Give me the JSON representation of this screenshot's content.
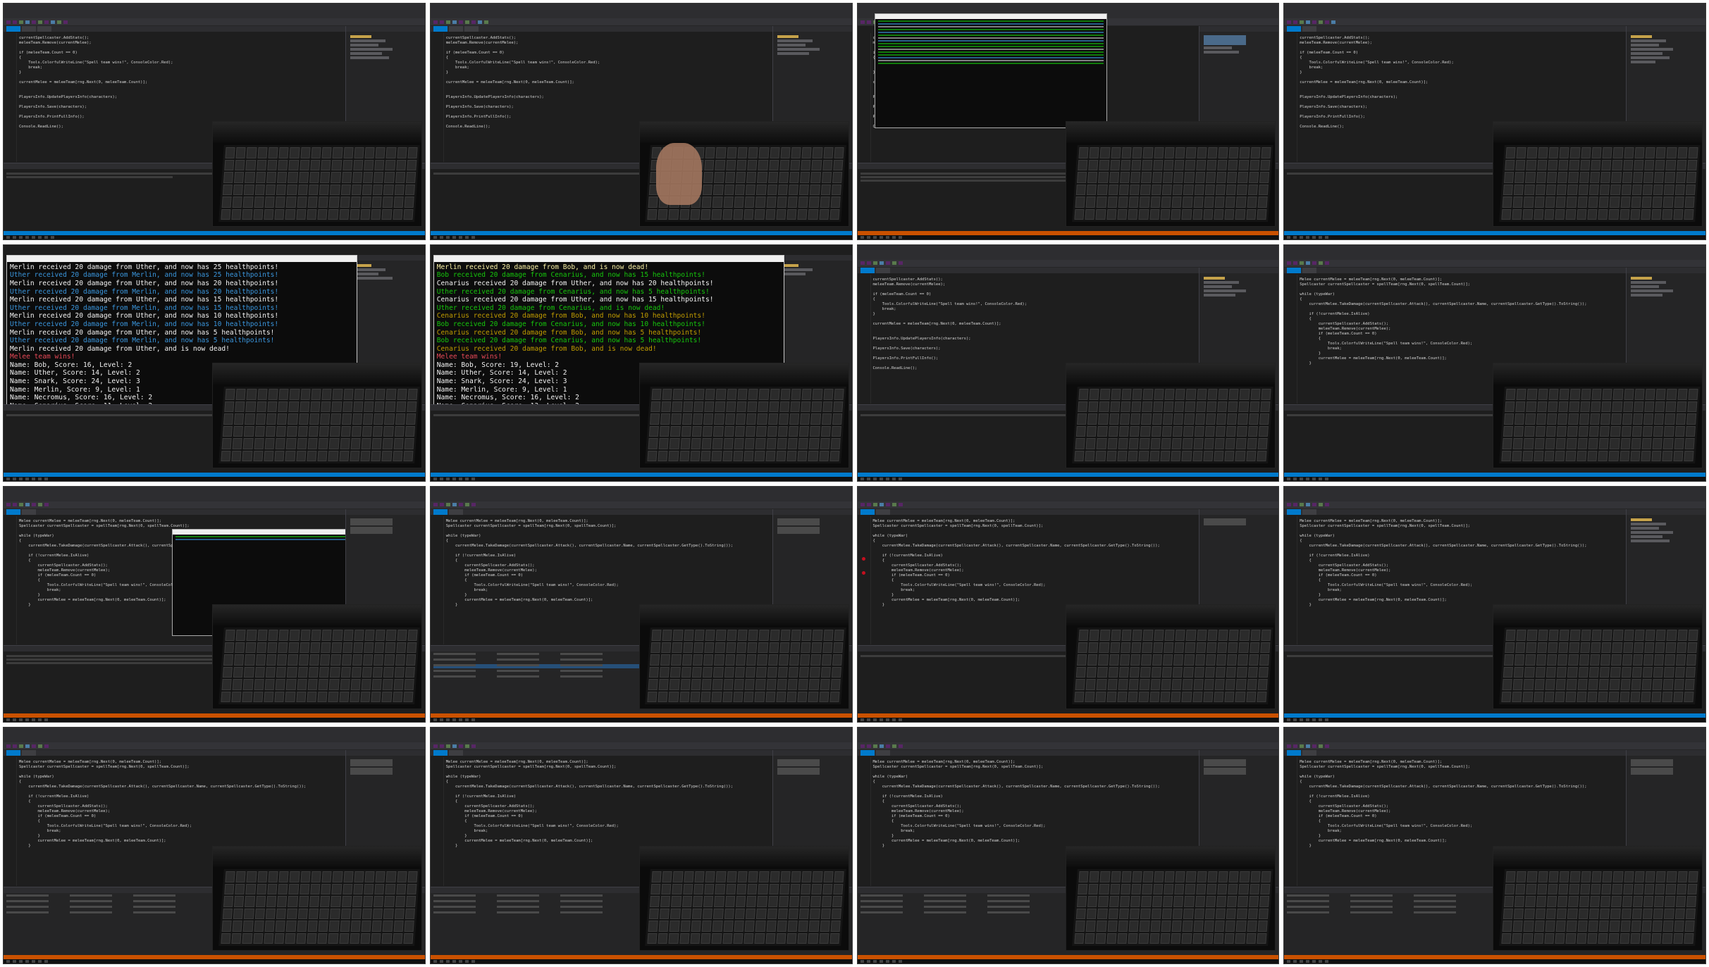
{
  "console_a": {
    "lines": [
      {
        "text": "Merlin received 20 damage from Uther, and now has 25 healthpoints!",
        "color": "white"
      },
      {
        "text": "Uther received 20 damage from Merlin, and now has 25 healthpoints!",
        "color": "cyan"
      },
      {
        "text": "Merlin received 20 damage from Uther, and now has 20 healthpoints!",
        "color": "white"
      },
      {
        "text": "Uther received 20 damage from Merlin, and now has 20 healthpoints!",
        "color": "cyan"
      },
      {
        "text": "Merlin received 20 damage from Uther, and now has 15 healthpoints!",
        "color": "white"
      },
      {
        "text": "Uther received 20 damage from Merlin, and now has 15 healthpoints!",
        "color": "cyan"
      },
      {
        "text": "Merlin received 20 damage from Uther, and now has 10 healthpoints!",
        "color": "white"
      },
      {
        "text": "Uther received 20 damage from Merlin, and now has 10 healthpoints!",
        "color": "cyan"
      },
      {
        "text": "Merlin received 20 damage from Uther, and now has 5 healthpoints!",
        "color": "white"
      },
      {
        "text": "Uther received 20 damage from Merlin, and now has 5 healthpoints!",
        "color": "cyan"
      },
      {
        "text": "Merlin received 20 damage from Uther, and is now dead!",
        "color": "white"
      },
      {
        "text": "",
        "color": "white"
      },
      {
        "text": "Melee team wins!",
        "color": "red"
      },
      {
        "text": "Name: Bob, Score: 16, Level: 2",
        "color": "white"
      },
      {
        "text": "Name: Uther, Score: 14, Level: 2",
        "color": "white"
      },
      {
        "text": "Name: Snark, Score: 24, Level: 3",
        "color": "white"
      },
      {
        "text": "Name: Merlin, Score: 9, Level: 1",
        "color": "white"
      },
      {
        "text": "Name: Necromus, Score: 16, Level: 2",
        "color": "white"
      },
      {
        "text": "Name: Cenarius, Score: 11, Level: 2",
        "color": "white"
      },
      {
        "text": "Press any key to continue . . .",
        "color": "white"
      }
    ]
  },
  "console_b": {
    "lines": [
      {
        "text": "Merlin received 20 damage from Bob, and is now dead!",
        "color": "yellow"
      },
      {
        "text": "Bob received 20 damage from Cenarius, and now has 15 healthpoints!",
        "color": "green"
      },
      {
        "text": "Cenarius received 20 damage from Uther, and now has 20 healthpoints!",
        "color": "white"
      },
      {
        "text": "Uther received 20 damage from Cenarius, and now has 5 healthpoints!",
        "color": "green"
      },
      {
        "text": "Cenarius received 20 damage from Uther, and now has 15 healthpoints!",
        "color": "white"
      },
      {
        "text": "Uther received 20 damage from Cenarius, and is now dead!",
        "color": "green"
      },
      {
        "text": "Cenarius received 20 damage from Bob, and now has 10 healthpoints!",
        "color": "dyellow"
      },
      {
        "text": "Bob received 20 damage from Cenarius, and now has 10 healthpoints!",
        "color": "green"
      },
      {
        "text": "Cenarius received 20 damage from Bob, and now has 5 healthpoints!",
        "color": "dyellow"
      },
      {
        "text": "Bob received 20 damage from Cenarius, and now has 5 healthpoints!",
        "color": "green"
      },
      {
        "text": "Cenarius received 20 damage from Bob, and is now dead!",
        "color": "dyellow"
      },
      {
        "text": "",
        "color": "white"
      },
      {
        "text": "Melee team wins!",
        "color": "red"
      },
      {
        "text": "Name: Bob, Score: 19, Level: 2",
        "color": "white"
      },
      {
        "text": "Name: Uther, Score: 14, Level: 2",
        "color": "white"
      },
      {
        "text": "Name: Snark, Score: 24, Level: 3",
        "color": "white"
      },
      {
        "text": "Name: Merlin, Score: 9, Level: 1",
        "color": "white"
      },
      {
        "text": "Name: Necromus, Score: 16, Level: 2",
        "color": "white"
      },
      {
        "text": "Name: Cenarius, Score: 13, Level: 2",
        "color": "white"
      },
      {
        "text": "Press any key to continue . . .",
        "color": "white"
      }
    ]
  },
  "code_snippets": {
    "a": [
      "currentSpellcaster.AddStats();",
      "meleeTeam.Remove(currentMelee);",
      "",
      "if (meleeTeam.Count == 0)",
      "{",
      "    Tools.ColorfulWriteLine(\"Spell team wins!\", ConsoleColor.Red);",
      "    break;",
      "}",
      "",
      "currentMelee = meleeTeam[rng.Next(0, meleeTeam.Count)];",
      "",
      "",
      "PlayersInfo.UpdatePlayersInfo(characters);",
      "",
      "PlayersInfo.Save(characters);",
      "",
      "PlayersInfo.PrintFullInfo();",
      "",
      "Console.ReadLine();"
    ],
    "b": [
      "Melee currentMelee = meleeTeam[rng.Next(0, meleeTeam.Count)];",
      "Spellcaster currentSpellcaster = spellTeam[rng.Next(0, spellTeam.Count)];",
      "",
      "while (typeWar)",
      "{",
      "    currentMelee.TakeDamage(currentSpellcaster.Attack(), currentSpellcaster.Name, currentSpellcaster.GetType().ToString());",
      "",
      "    if (!currentMelee.IsAlive)",
      "    {",
      "        currentSpellcaster.AddStats();",
      "        meleeTeam.Remove(currentMelee);",
      "        if (meleeTeam.Count == 0)",
      "        {",
      "            Tools.ColorfulWriteLine(\"Spell team wins!\", ConsoleColor.Red);",
      "            break;",
      "        }",
      "        currentMelee = meleeTeam[rng.Next(0, meleeTeam.Count)];",
      "    }"
    ]
  }
}
